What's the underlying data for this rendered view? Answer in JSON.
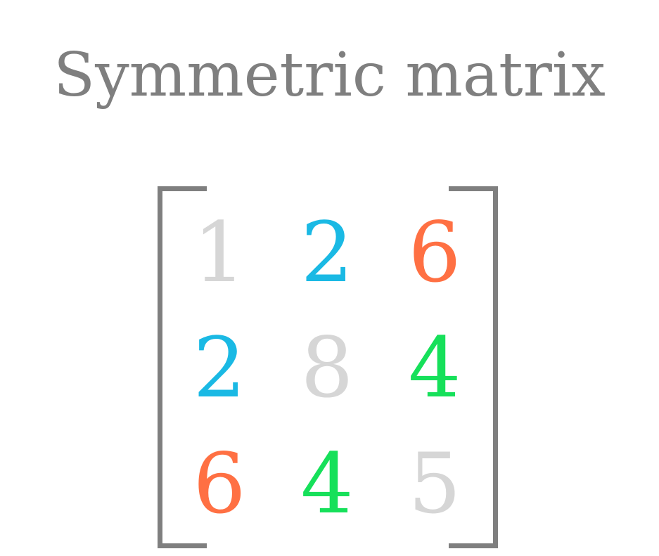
{
  "title": "Symmetric matrix",
  "colors": {
    "title": "#7f7f7f",
    "bracket": "#7f7f7f",
    "diagonal": "#d6d6d6",
    "blue": "#1ab9e4",
    "orange": "#ff7043",
    "green": "#16e05a"
  },
  "matrix": {
    "rows": [
      [
        {
          "value": "1",
          "color": "#d6d6d6"
        },
        {
          "value": "2",
          "color": "#1ab9e4"
        },
        {
          "value": "6",
          "color": "#ff7043"
        }
      ],
      [
        {
          "value": "2",
          "color": "#1ab9e4"
        },
        {
          "value": "8",
          "color": "#d6d6d6"
        },
        {
          "value": "4",
          "color": "#16e05a"
        }
      ],
      [
        {
          "value": "6",
          "color": "#ff7043"
        },
        {
          "value": "4",
          "color": "#16e05a"
        },
        {
          "value": "5",
          "color": "#d6d6d6"
        }
      ]
    ]
  }
}
